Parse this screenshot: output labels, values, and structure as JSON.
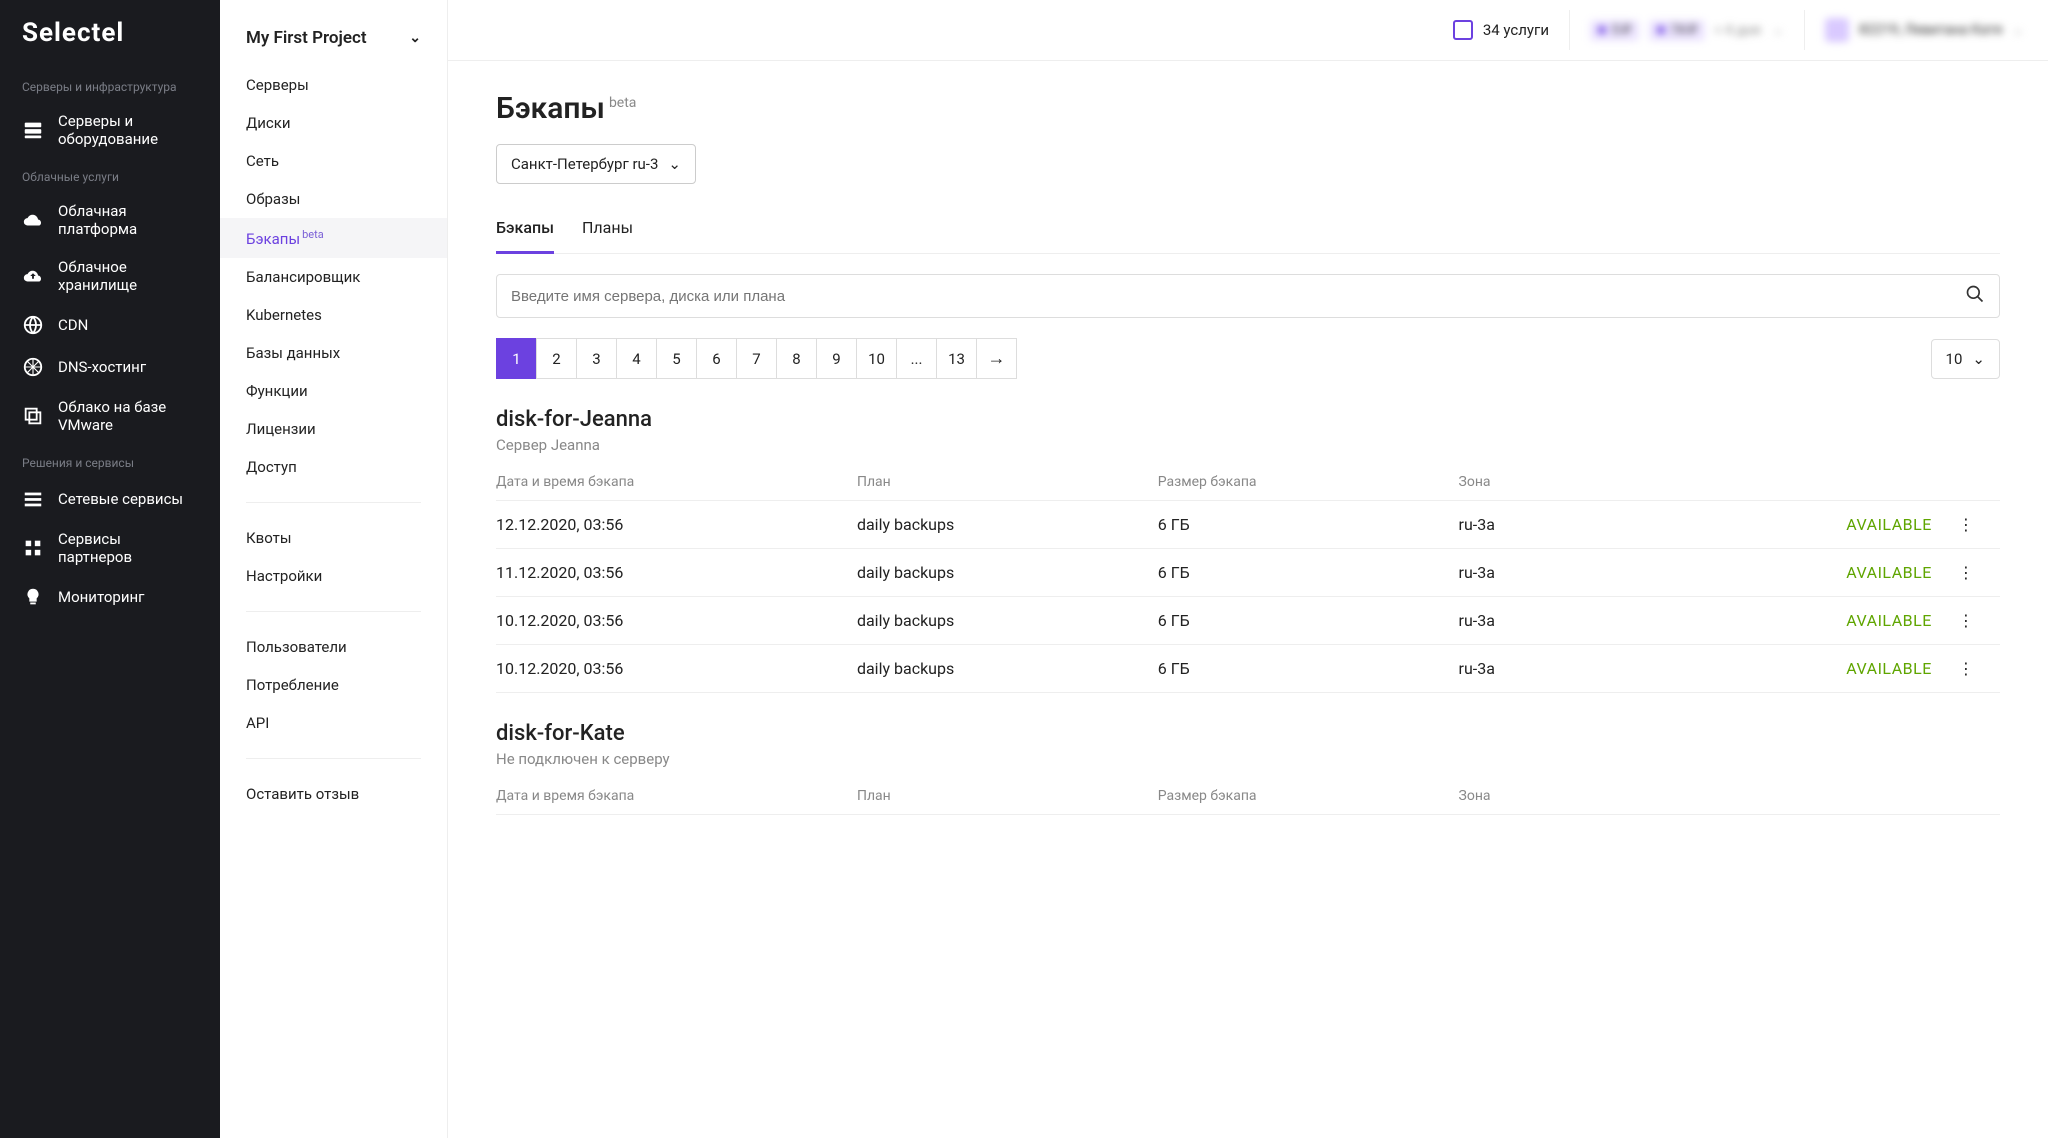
{
  "logo": "Selectel",
  "sidebar": {
    "sections": [
      {
        "label": "Серверы и инфраструктура",
        "items": [
          {
            "icon": "servers",
            "label": "Серверы и оборудование"
          }
        ]
      },
      {
        "label": "Облачные услуги",
        "items": [
          {
            "icon": "cloud",
            "label": "Облачная платформа"
          },
          {
            "icon": "cloud-up",
            "label": "Облачное хранилище"
          },
          {
            "icon": "globe",
            "label": "CDN"
          },
          {
            "icon": "globe-grid",
            "label": "DNS-хостинг"
          },
          {
            "icon": "stack",
            "label": "Облако на базе VMware"
          }
        ]
      },
      {
        "label": "Решения и сервисы",
        "items": [
          {
            "icon": "bars",
            "label": "Сетевые сервисы"
          },
          {
            "icon": "grid",
            "label": "Сервисы партнеров"
          },
          {
            "icon": "bulb",
            "label": "Мониторинг"
          }
        ]
      }
    ]
  },
  "project": {
    "name": "My First Project",
    "nav": [
      {
        "label": "Серверы"
      },
      {
        "label": "Диски"
      },
      {
        "label": "Сеть"
      },
      {
        "label": "Образы"
      },
      {
        "label": "Бэкапы",
        "badge": "beta",
        "active": true
      },
      {
        "label": "Балансировщик"
      },
      {
        "label": "Kubernetes"
      },
      {
        "label": "Базы данных"
      },
      {
        "label": "Функции"
      },
      {
        "label": "Лицензии"
      },
      {
        "label": "Доступ"
      }
    ],
    "nav2": [
      {
        "label": "Квоты"
      },
      {
        "label": "Настройки"
      }
    ],
    "nav3": [
      {
        "label": "Пользователи"
      },
      {
        "label": "Потребление"
      },
      {
        "label": "API"
      }
    ],
    "nav4": [
      {
        "label": "Оставить отзыв"
      }
    ]
  },
  "topbar": {
    "services_count": "34 услуги",
    "balance1": "5 ₽",
    "balance2": "74 ₽",
    "balance_note": "< 4 дня",
    "user": "82219, Левитана Катя"
  },
  "page": {
    "title": "Бэкапы",
    "title_badge": "beta",
    "region": "Санкт-Петербург ru-3",
    "tabs": [
      {
        "label": "Бэкапы",
        "active": true
      },
      {
        "label": "Планы"
      }
    ],
    "search_placeholder": "Введите имя сервера, диска или плана",
    "pagination": {
      "pages": [
        "1",
        "2",
        "3",
        "4",
        "5",
        "6",
        "7",
        "8",
        "9",
        "10",
        "...",
        "13"
      ],
      "active": "1",
      "per_page": "10"
    },
    "columns": {
      "date": "Дата и время бэкапа",
      "plan": "План",
      "size": "Размер бэкапа",
      "zone": "Зона"
    },
    "groups": [
      {
        "title": "disk-for-Jeanna",
        "subtitle": "Сервер Jeanna",
        "rows": [
          {
            "date": "12.12.2020, 03:56",
            "plan": "daily backups",
            "size": "6 ГБ",
            "zone": "ru-3a",
            "status": "AVAILABLE"
          },
          {
            "date": "11.12.2020, 03:56",
            "plan": "daily backups",
            "size": "6 ГБ",
            "zone": "ru-3a",
            "status": "AVAILABLE"
          },
          {
            "date": "10.12.2020, 03:56",
            "plan": "daily backups",
            "size": "6 ГБ",
            "zone": "ru-3a",
            "status": "AVAILABLE"
          },
          {
            "date": "10.12.2020, 03:56",
            "plan": "daily backups",
            "size": "6 ГБ",
            "zone": "ru-3a",
            "status": "AVAILABLE"
          }
        ]
      },
      {
        "title": "disk-for-Kate",
        "subtitle": "Не подключен к серверу",
        "rows": []
      }
    ]
  }
}
